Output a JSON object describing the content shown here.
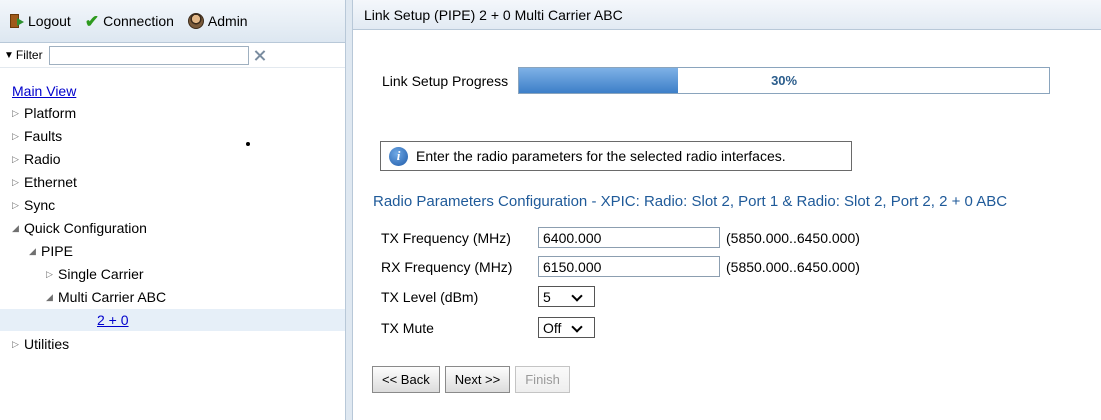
{
  "toolbar": {
    "logout_label": "Logout",
    "connection_label": "Connection",
    "admin_label": "Admin"
  },
  "filter": {
    "label": "Filter",
    "value": ""
  },
  "tree": {
    "main_view": "Main View",
    "platform": "Platform",
    "faults": "Faults",
    "radio": "Radio",
    "ethernet": "Ethernet",
    "sync": "Sync",
    "quick_configuration": "Quick Configuration",
    "pipe": "PIPE",
    "single_carrier": "Single Carrier",
    "multi_carrier_abc": "Multi Carrier ABC",
    "two_plus_zero": "2 + 0",
    "utilities": "Utilities"
  },
  "panel": {
    "title": "Link Setup (PIPE) 2 + 0 Multi Carrier ABC",
    "progress_label": "Link Setup Progress",
    "progress_value": 30,
    "progress_text": "30%",
    "info_text": "Enter the radio parameters for the selected radio interfaces.",
    "section_title": "Radio Parameters Configuration - XPIC: Radio: Slot 2, Port 1 & Radio: Slot 2, Port 2, 2 + 0 ABC",
    "tx_freq_label": "TX Frequency (MHz)",
    "tx_freq_value": "6400.000",
    "tx_freq_range": "(5850.000..6450.000)",
    "rx_freq_label": "RX Frequency (MHz)",
    "rx_freq_value": "6150.000",
    "rx_freq_range": "(5850.000..6450.000)",
    "tx_level_label": "TX Level (dBm)",
    "tx_level_value": "5",
    "tx_mute_label": "TX Mute",
    "tx_mute_value": "Off"
  },
  "buttons": {
    "back": "<< Back",
    "next": "Next >>",
    "finish": "Finish"
  },
  "colors": {
    "accent": "#1f5a99",
    "progress_fill": "#3d7fc8",
    "link": "#0000cc"
  }
}
